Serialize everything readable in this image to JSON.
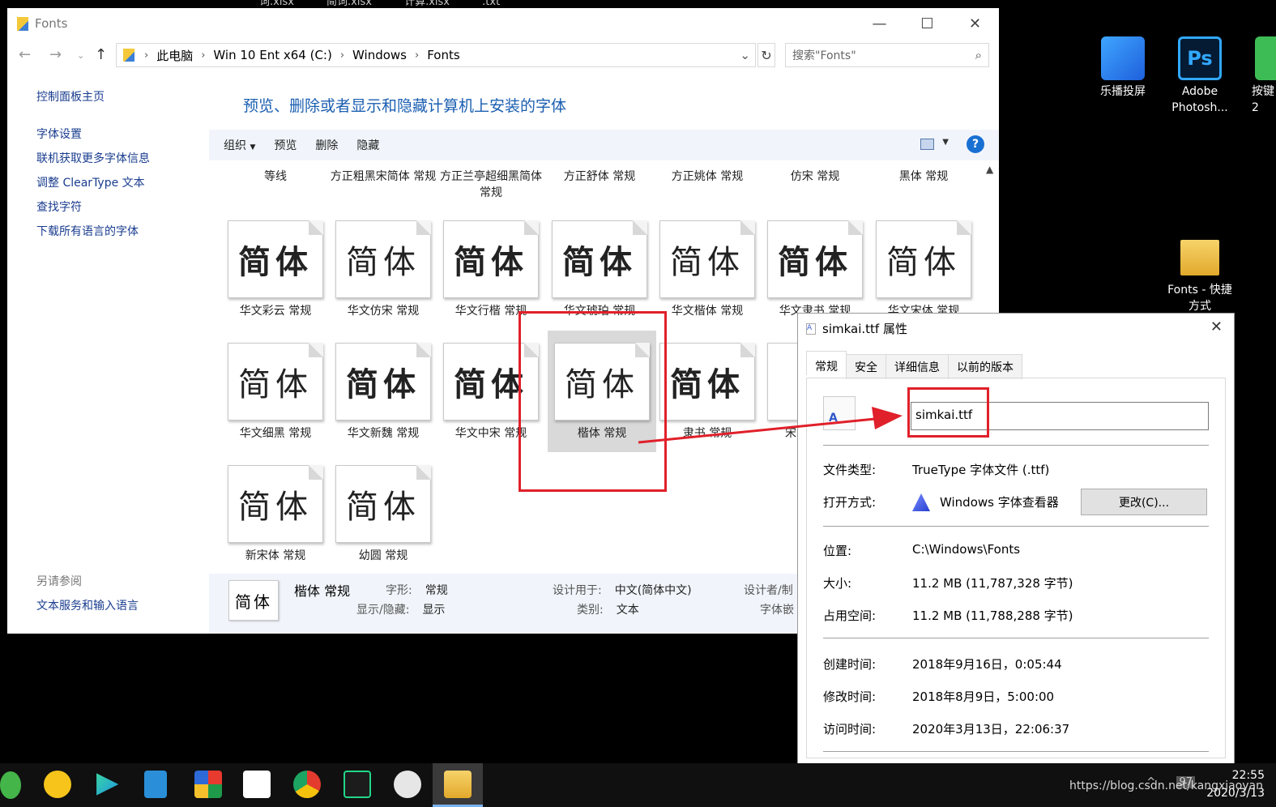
{
  "top_filenames": [
    "词.xlsx",
    "简词.xlsx",
    "计算.xlsx",
    ".txt"
  ],
  "explorer": {
    "title": "Fonts",
    "controls": {
      "minimize": "—",
      "maximize": "☐",
      "close": "✕"
    },
    "breadcrumb": [
      "此电脑",
      "Win 10 Ent x64 (C:)",
      "Windows",
      "Fonts"
    ],
    "search_placeholder": "搜索\"Fonts\"",
    "sidebar": {
      "home": "控制面板主页",
      "links": [
        "字体设置",
        "联机获取更多字体信息",
        "调整 ClearType 文本",
        "查找字符",
        "下载所有语言的字体"
      ],
      "see_also_title": "另请参阅",
      "see_also_link": "文本服务和输入语言"
    },
    "headline": "预览、删除或者显示和隐藏计算机上安装的字体",
    "toolbar": {
      "organize": "组织",
      "preview": "预览",
      "delete": "删除",
      "hide": "隐藏",
      "help": "?"
    },
    "top_row_labels": [
      "等线",
      "方正粗黑宋简体 常规",
      "方正兰亭超细黑简体 常规",
      "方正舒体 常规",
      "方正姚体 常规",
      "仿宋 常规",
      "黑体 常规"
    ],
    "row1": [
      {
        "sample": "简体",
        "label": "华文彩云 常规"
      },
      {
        "sample": "简体",
        "label": "华文仿宋 常规"
      },
      {
        "sample": "简体",
        "label": "华文行楷 常规"
      },
      {
        "sample": "简体",
        "label": "华文琥珀 常规"
      },
      {
        "sample": "简体",
        "label": "华文楷体 常规"
      },
      {
        "sample": "简体",
        "label": "华文隶书 常规"
      },
      {
        "sample": "简体",
        "label": "华文宋体 常规"
      }
    ],
    "row2": [
      {
        "sample": "简体",
        "label": "华文细黑 常规"
      },
      {
        "sample": "简体",
        "label": "华文新魏 常规"
      },
      {
        "sample": "简体",
        "label": "华文中宋 常规"
      },
      {
        "sample": "简体",
        "label": "楷体 常规"
      },
      {
        "sample": "简体",
        "label": "隶书 常规"
      },
      {
        "sample": "简",
        "label": "宋"
      }
    ],
    "row3": [
      {
        "sample": "简体",
        "label": "新宋体 常规"
      },
      {
        "sample": "简体",
        "label": "幼圆 常规"
      }
    ],
    "details": {
      "thumb": "简体",
      "name": "楷体 常规",
      "style_label": "字形:",
      "style_value": "常规",
      "show_label": "显示/隐藏:",
      "show_value": "显示",
      "designed_label": "设计用于:",
      "designed_value": "中文(简体中文)",
      "category_label": "类别:",
      "category_value": "文本",
      "designer_label": "设计者/制",
      "embed_label": "字体嵌"
    }
  },
  "properties": {
    "title": "simkai.ttf 属性",
    "close": "✕",
    "tabs": [
      "常规",
      "安全",
      "详细信息",
      "以前的版本"
    ],
    "filename": "simkai.ttf",
    "file_type_label": "文件类型:",
    "file_type": "TrueType 字体文件 (.ttf)",
    "open_with_label": "打开方式:",
    "open_with": "Windows 字体查看器",
    "change_button": "更改(C)...",
    "location_label": "位置:",
    "location": "C:\\Windows\\Fonts",
    "size_label": "大小:",
    "size": "11.2 MB (11,787,328 字节)",
    "disk_label": "占用空间:",
    "disk": "11.2 MB (11,788,288 字节)",
    "created_label": "创建时间:",
    "created": "2018年9月16日，0:05:44",
    "modified_label": "修改时间:",
    "modified": "2018年8月9日，5:00:00",
    "accessed_label": "访问时间:",
    "accessed": "2020年3月13日，22:06:37"
  },
  "desktop": [
    {
      "name": "乐播投屏"
    },
    {
      "name": "Adobe Photosh...",
      "badge": "Ps"
    },
    {
      "name": "按键 2"
    },
    {
      "name": "Fonts - 快捷方式"
    }
  ],
  "taskbar": {
    "tray_number": "97",
    "time": "22:55",
    "date": "2020/3/13",
    "watermark": "https://blog.csdn.net/kangxiaoyan"
  }
}
